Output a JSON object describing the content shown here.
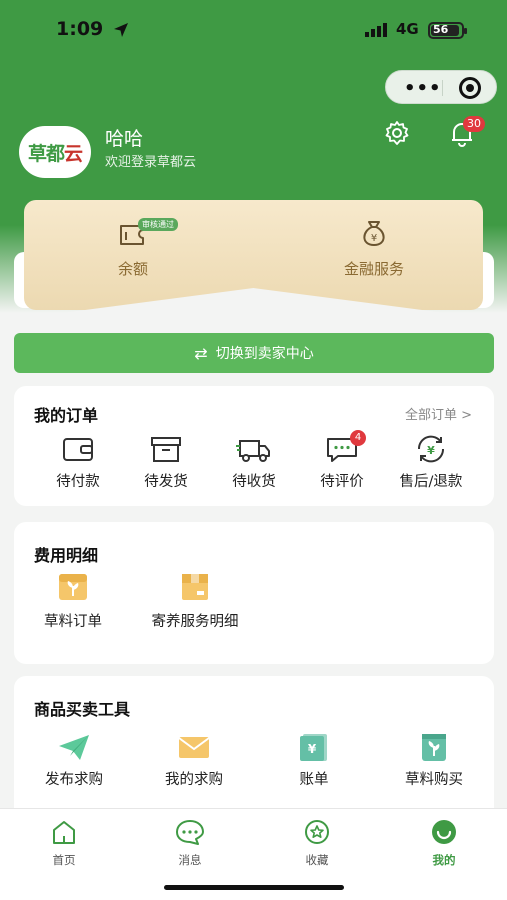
{
  "status_bar": {
    "time": "1:09",
    "network": "4G",
    "battery": "56"
  },
  "capsule": {
    "more_label": "•••"
  },
  "header": {
    "logo_text_a": "草都",
    "logo_text_b": "云",
    "user_name": "哈哈",
    "welcome": "欢迎登录草都云",
    "notification_count": "30"
  },
  "finance": {
    "items": [
      {
        "label": "余额",
        "icon": "wallet-icon",
        "tag": "审核通过"
      },
      {
        "label": "金融服务",
        "icon": "money-bag-icon"
      }
    ]
  },
  "switch_button": {
    "label": "切换到卖家中心"
  },
  "orders": {
    "title": "我的订单",
    "all_label": "全部订单 >",
    "items": [
      {
        "label": "待付款",
        "icon": "wallet-icon"
      },
      {
        "label": "待发货",
        "icon": "box-icon"
      },
      {
        "label": "待收货",
        "icon": "truck-icon"
      },
      {
        "label": "待评价",
        "icon": "comment-icon",
        "badge": "4"
      },
      {
        "label": "售后/退款",
        "icon": "refund-icon"
      }
    ]
  },
  "expenses": {
    "title": "费用明细",
    "items": [
      {
        "label": "草料订单",
        "icon": "forage-order-icon"
      },
      {
        "label": "寄养服务明细",
        "icon": "foster-service-icon"
      }
    ]
  },
  "tools": {
    "title": "商品买卖工具",
    "items": [
      {
        "label": "发布求购",
        "icon": "paper-plane-icon"
      },
      {
        "label": "我的求购",
        "icon": "envelope-icon"
      },
      {
        "label": "账单",
        "icon": "bill-icon"
      },
      {
        "label": "草料购买",
        "icon": "forage-bag-icon"
      }
    ]
  },
  "tabbar": {
    "items": [
      {
        "label": "首页",
        "icon": "home-icon"
      },
      {
        "label": "消息",
        "icon": "message-icon"
      },
      {
        "label": "收藏",
        "icon": "star-icon"
      },
      {
        "label": "我的",
        "icon": "profile-icon",
        "active": true
      }
    ]
  },
  "colors": {
    "brand": "#3f9a44",
    "accent_button": "#5cb85c",
    "badge": "#e0393e",
    "gold": "#ecd9b1"
  }
}
